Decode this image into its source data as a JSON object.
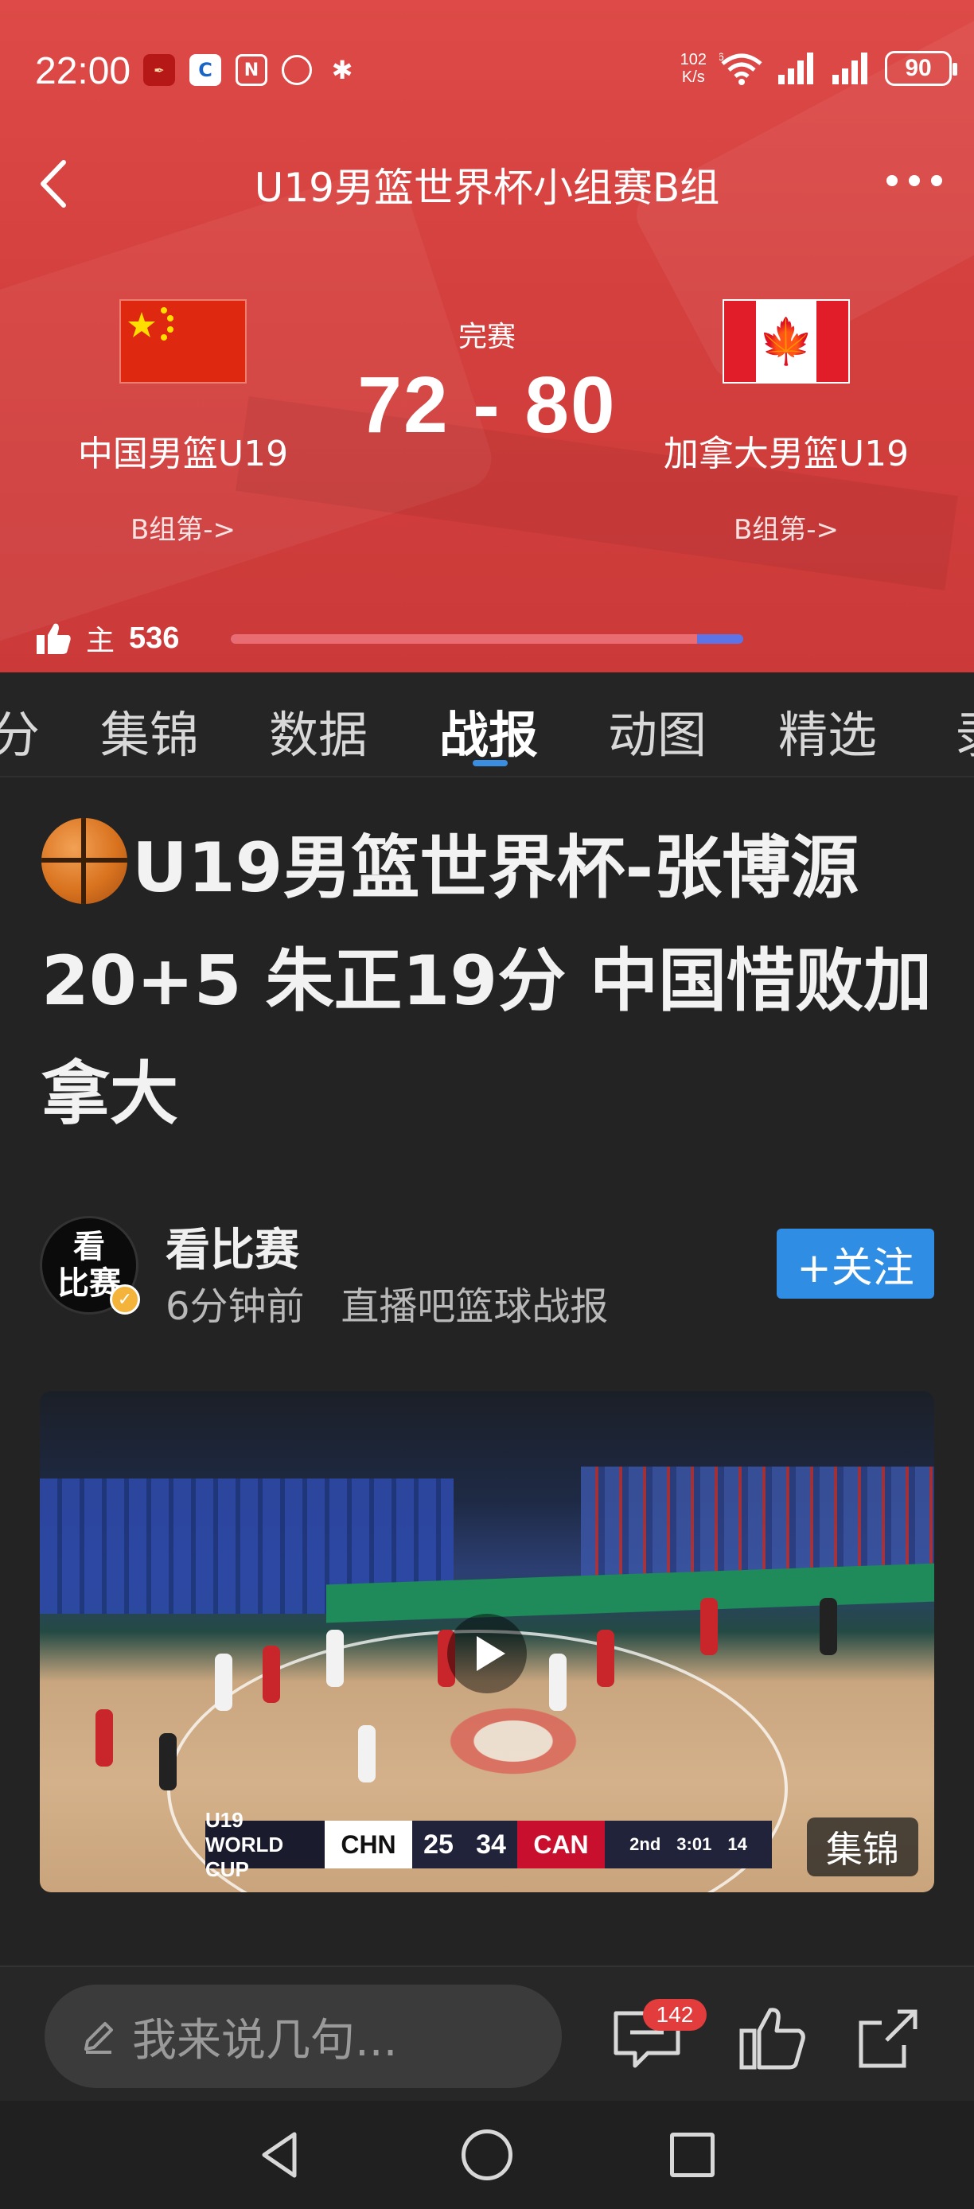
{
  "status_bar": {
    "time": "22:00",
    "net_speed_value": "102",
    "net_speed_unit": "K/s",
    "wifi_badge": "6",
    "battery": "90",
    "icons": [
      "news-app-icon",
      "c-app-icon",
      "nfc-icon",
      "alarm-icon",
      "bluetooth-icon",
      "wifi-icon",
      "signal-icon",
      "signal-icon",
      "battery-icon"
    ]
  },
  "nav": {
    "title": "U19男篮世界杯小组赛B组"
  },
  "match": {
    "state": "完赛",
    "score": "72 - 80",
    "home": {
      "name": "中国男篮U19",
      "group": "B组第->",
      "flag": "china-flag"
    },
    "away": {
      "name": "加拿大男篮U19",
      "group": "B组第->",
      "flag": "canada-flag"
    },
    "support": {
      "label": "主",
      "count": "536",
      "home_share": 0.91
    }
  },
  "tabs": [
    "分",
    "集锦",
    "数据",
    "战报",
    "动图",
    "精选",
    "录"
  ],
  "active_tab": "战报",
  "article": {
    "title": "U19男篮世界杯-张博源20+5 朱正19分 中国惜败加拿大",
    "author": {
      "avatar_text_1": "看",
      "avatar_text_2": "比赛",
      "name": "看比赛",
      "time_ago": "6分钟前",
      "source": "直播吧篮球战报",
      "follow_label": "+关注"
    },
    "video": {
      "badge": "集锦",
      "scorebug": {
        "event": "U19 WORLD CUP",
        "team1": "CHN",
        "score1": "25",
        "score2": "34",
        "team2": "CAN",
        "period": "2nd",
        "clock": "3:01",
        "shot_clock": "14"
      }
    }
  },
  "bottom_bar": {
    "comment_placeholder": "我来说几句...",
    "comment_count": "142"
  },
  "colors": {
    "header_red": "#d4403e",
    "accent_blue": "#2f8de4",
    "badge_red": "#e23c3c",
    "page_bg": "#232323"
  }
}
